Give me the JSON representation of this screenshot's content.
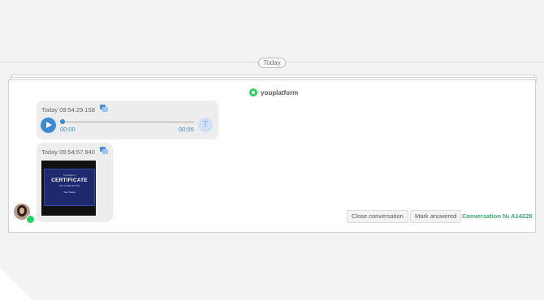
{
  "timeline": {
    "date_label": "Today"
  },
  "conversation": {
    "channel_name": "youplatform",
    "channel_icon": "whatsapp-icon",
    "messages": [
      {
        "type": "audio",
        "timestamp": "Today 09:54:29.158",
        "current_time": "00:00",
        "duration": "00:05",
        "transcribe_label": "T"
      },
      {
        "type": "image",
        "timestamp": "Today 09:54:57.940",
        "image": {
          "small_top": "Youplatform",
          "title": "CERTIFICATE",
          "subtitle": "OF COMPLETION",
          "name_line": "Your Name"
        }
      }
    ],
    "actions": {
      "close_label": "Close conversation",
      "mark_label": "Mark answered"
    },
    "conversation_number": "Conversation № A14229",
    "accent_color": "#3aa86a",
    "brand_color": "#25d366"
  }
}
